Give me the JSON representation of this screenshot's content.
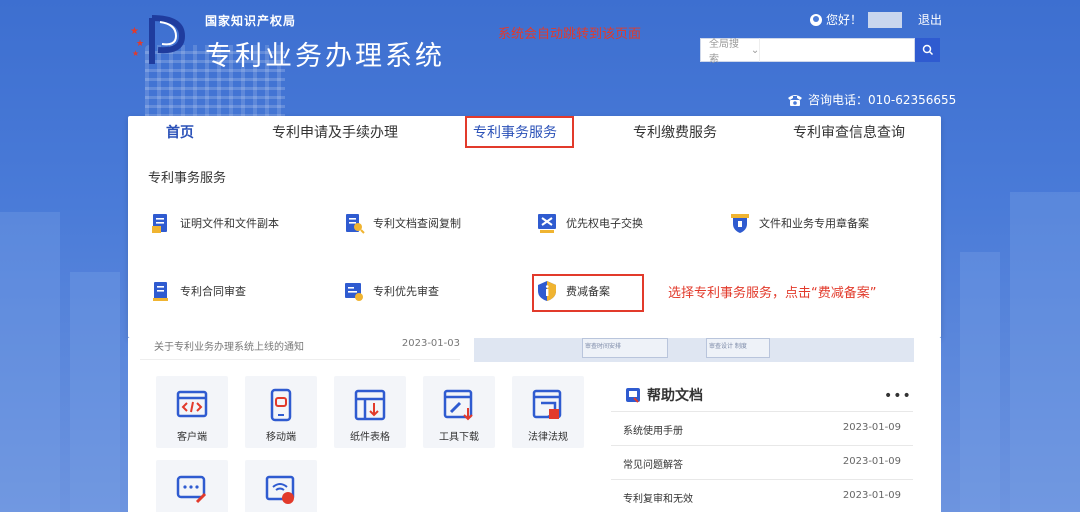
{
  "header": {
    "org_name": "国家知识产权局",
    "system_name": "专利业务办理系统",
    "redirect_note": "系统会自动跳转到该页面",
    "greeting": "您好！",
    "logout": "退出",
    "search_select": "全局搜索",
    "search_placeholder": "",
    "hotline": "咨询电话：010-62356655"
  },
  "nav": {
    "items": [
      {
        "label": "首页"
      },
      {
        "label": "专利申请及手续办理"
      },
      {
        "label": "专利事务服务"
      },
      {
        "label": "专利缴费服务"
      },
      {
        "label": "专利审查信息查询"
      }
    ]
  },
  "submenu": {
    "title": "专利事务服务",
    "items": [
      {
        "label": "证明文件和文件副本",
        "icon": "document-certificate-icon"
      },
      {
        "label": "专利文档查阅复制",
        "icon": "document-search-icon"
      },
      {
        "label": "优先权电子交换",
        "icon": "exchange-icon"
      },
      {
        "label": "文件和业务专用章备案",
        "icon": "stamp-shield-icon"
      },
      {
        "label": "专利合同审查",
        "icon": "contract-icon"
      },
      {
        "label": "专利优先审查",
        "icon": "priority-review-icon"
      },
      {
        "label": "费减备案",
        "icon": "fee-reduction-shield-icon"
      }
    ],
    "instruction": "选择专利事务服务，点击“费减备案”"
  },
  "news": {
    "title": "关于专利业务办理系统上线的通知",
    "date": "2023-01-03"
  },
  "strip": {
    "box1": "审查时间安排",
    "box2": "审查设计\n制度"
  },
  "tiles": [
    {
      "label": "客户端",
      "icon": "code-window-icon"
    },
    {
      "label": "移动端",
      "icon": "mobile-icon"
    },
    {
      "label": "纸件表格",
      "icon": "table-form-icon"
    },
    {
      "label": "工具下载",
      "icon": "tools-download-icon"
    },
    {
      "label": "法律法规",
      "icon": "law-icon"
    },
    {
      "label": "",
      "icon": "message-edit-icon"
    },
    {
      "label": "",
      "icon": "wifi-security-icon"
    }
  ],
  "help": {
    "title": "帮助文档",
    "more": "•••",
    "rows": [
      {
        "title": "系统使用手册",
        "date": "2023-01-09"
      },
      {
        "title": "常见问题解答",
        "date": "2023-01-09"
      },
      {
        "title": "专利复审和无效",
        "date": "2023-01-09"
      }
    ]
  },
  "colors": {
    "accent_blue": "#2c52b8",
    "highlight_red": "#e23a2b",
    "page_bg": "#4a7bd8"
  }
}
